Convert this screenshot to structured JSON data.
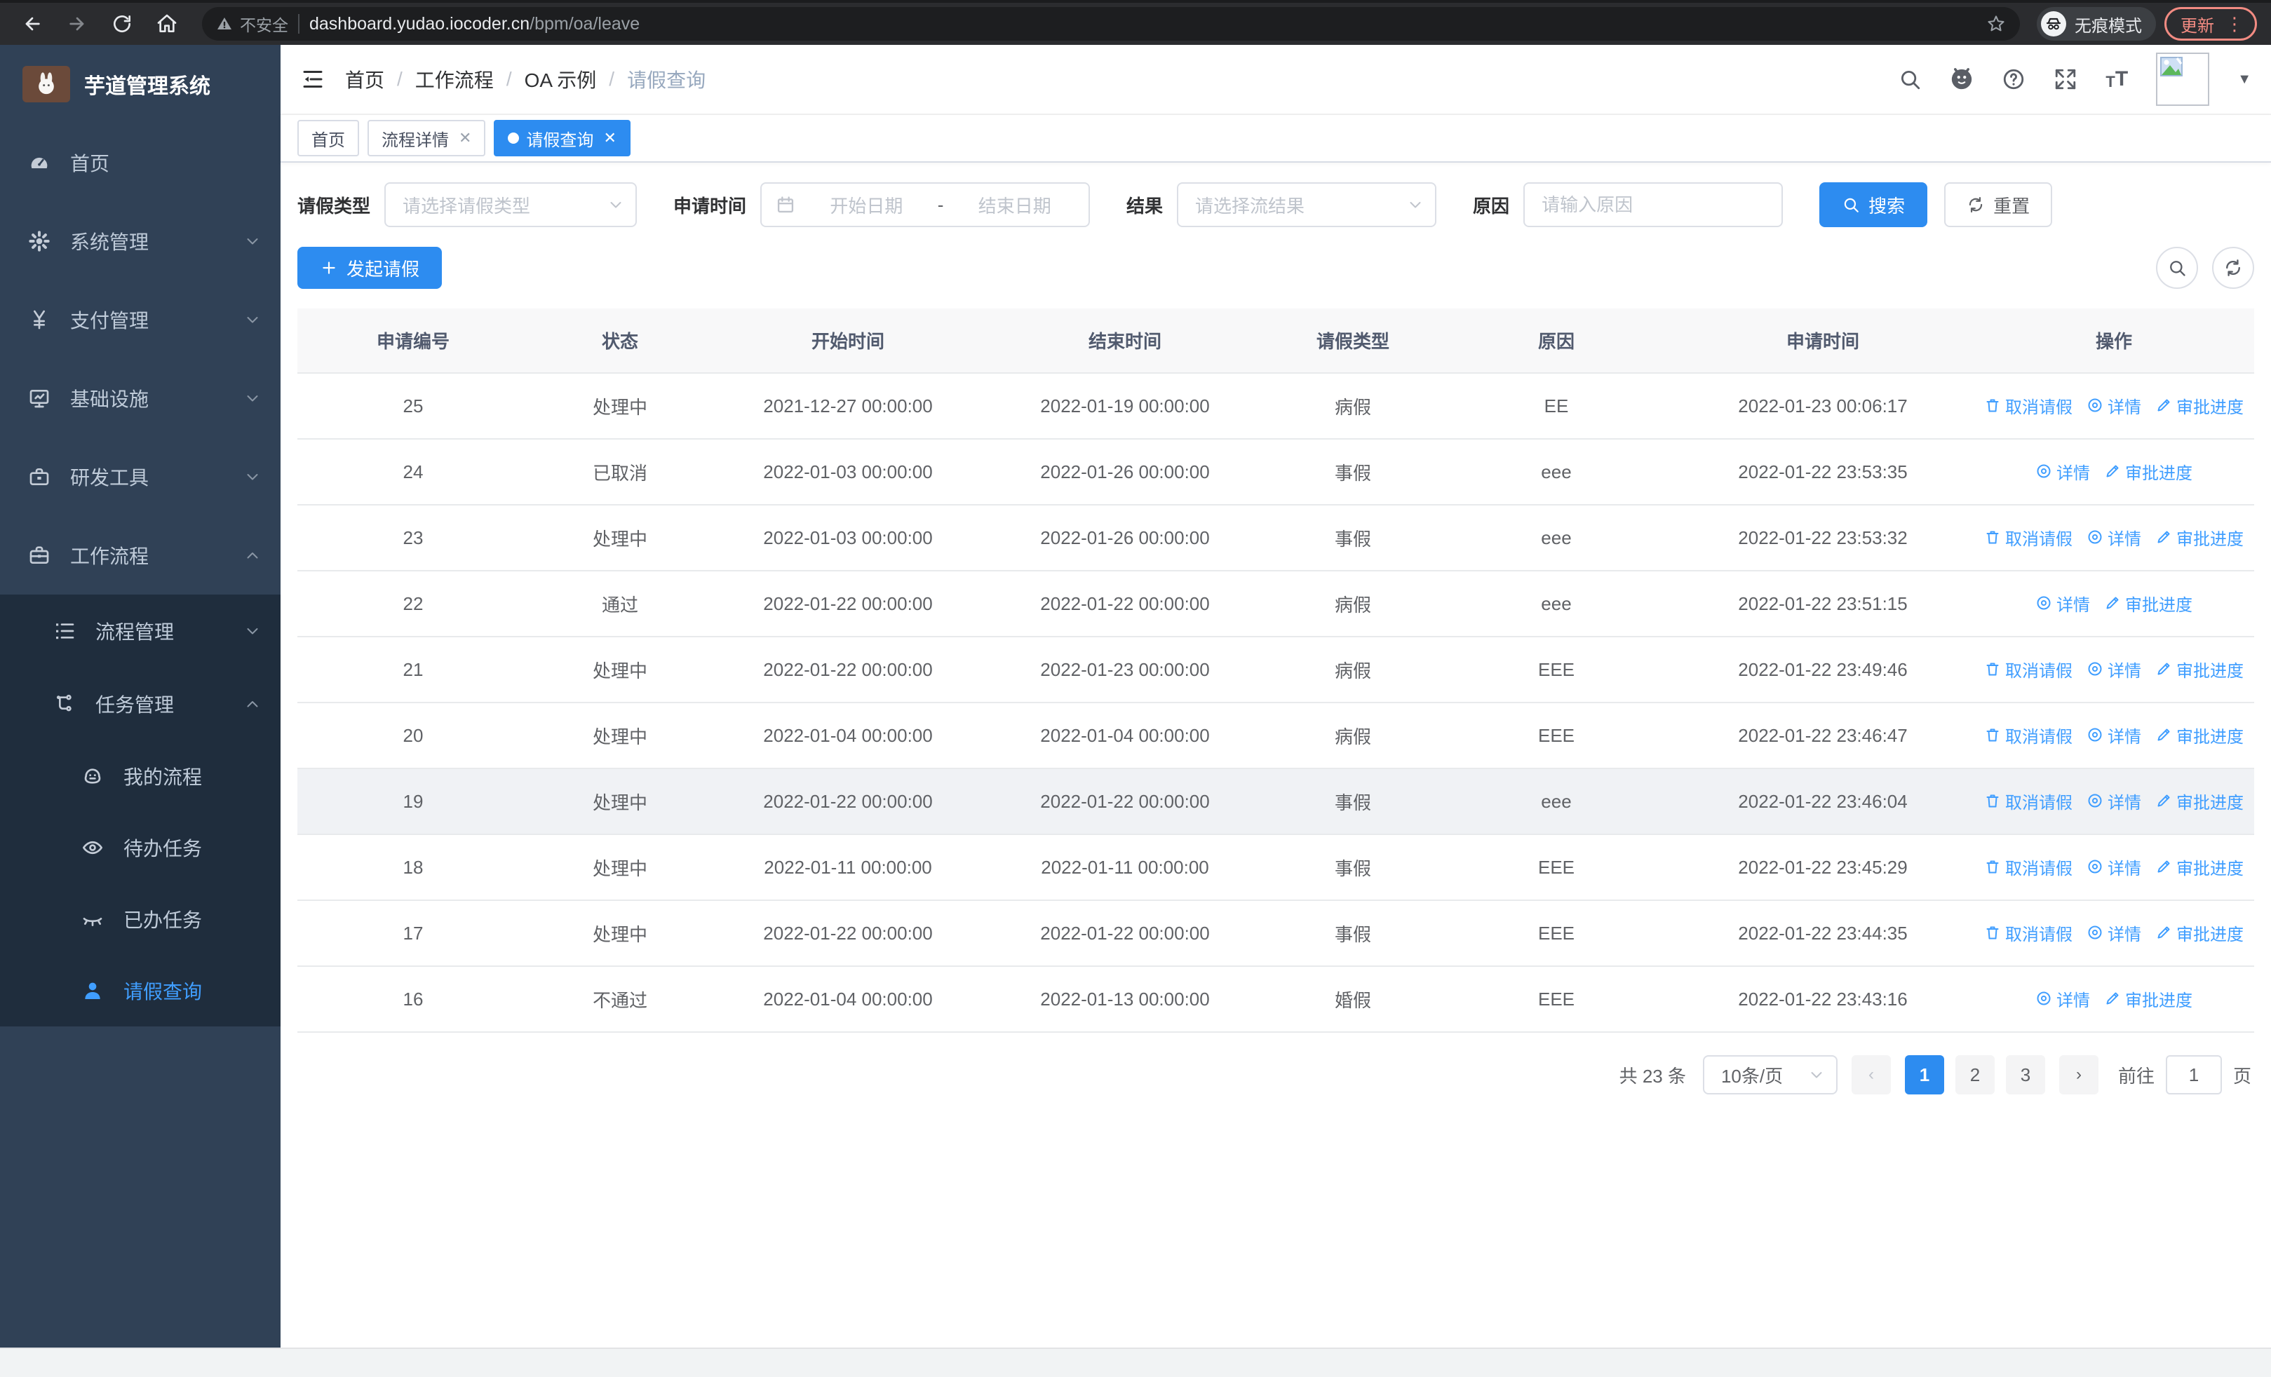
{
  "browser": {
    "security_label": "不安全",
    "url_host": "dashboard.yudao.iocoder.cn",
    "url_path": "/bpm/oa/leave",
    "incognito_label": "无痕模式",
    "update_label": "更新"
  },
  "sidebar": {
    "logo_title": "芋道管理系统",
    "menu": [
      {
        "key": "home",
        "icon": "dashboard-icon",
        "label": "首页",
        "level": 1,
        "sub": false,
        "chevron": "",
        "active": false
      },
      {
        "key": "system",
        "icon": "gear-icon",
        "label": "系统管理",
        "level": 1,
        "sub": false,
        "chevron": "down",
        "active": false
      },
      {
        "key": "payment",
        "icon": "yen-icon",
        "label": "支付管理",
        "level": 1,
        "sub": false,
        "chevron": "down",
        "active": false
      },
      {
        "key": "infra",
        "icon": "monitor-icon",
        "label": "基础设施",
        "level": 1,
        "sub": false,
        "chevron": "down",
        "active": false
      },
      {
        "key": "dev-tools",
        "icon": "toolbox-icon",
        "label": "研发工具",
        "level": 1,
        "sub": false,
        "chevron": "down",
        "active": false
      },
      {
        "key": "workflow",
        "icon": "briefcase-icon",
        "label": "工作流程",
        "level": 1,
        "sub": false,
        "chevron": "up",
        "active": false
      },
      {
        "key": "process-mgmt",
        "icon": "list-icon",
        "label": "流程管理",
        "level": 2,
        "sub": true,
        "chevron": "down",
        "active": false
      },
      {
        "key": "task-mgmt",
        "icon": "flow-icon",
        "label": "任务管理",
        "level": 2,
        "sub": true,
        "chevron": "up",
        "active": false
      },
      {
        "key": "my-process",
        "icon": "robot-icon",
        "label": "我的流程",
        "level": 3,
        "sub": true,
        "chevron": "",
        "active": false
      },
      {
        "key": "todo-tasks",
        "icon": "eye-icon",
        "label": "待办任务",
        "level": 3,
        "sub": true,
        "chevron": "",
        "active": false
      },
      {
        "key": "done-tasks",
        "icon": "eye-closed-icon",
        "label": "已办任务",
        "level": 3,
        "sub": true,
        "chevron": "",
        "active": false
      },
      {
        "key": "leave-query",
        "icon": "user-icon",
        "label": "请假查询",
        "level": 3,
        "sub": true,
        "chevron": "",
        "active": true
      }
    ]
  },
  "breadcrumb": [
    "首页",
    "工作流程",
    "OA 示例",
    "请假查询"
  ],
  "tabs": [
    {
      "key": "home",
      "label": "首页",
      "active": false,
      "closable": false,
      "dot": false
    },
    {
      "key": "process-detail",
      "label": "流程详情",
      "active": false,
      "closable": true,
      "dot": false
    },
    {
      "key": "leave-query",
      "label": "请假查询",
      "active": true,
      "closable": true,
      "dot": true
    }
  ],
  "filters": {
    "leave_type_label": "请假类型",
    "leave_type_placeholder": "请选择请假类型",
    "apply_time_label": "申请时间",
    "date_start_placeholder": "开始日期",
    "date_separator": "-",
    "date_end_placeholder": "结束日期",
    "result_label": "结果",
    "result_placeholder": "请选择流结果",
    "reason_label": "原因",
    "reason_placeholder": "请输入原因",
    "search_label": "搜索",
    "reset_label": "重置"
  },
  "toolbar": {
    "create_label": "发起请假"
  },
  "table": {
    "columns": [
      "申请编号",
      "状态",
      "开始时间",
      "结束时间",
      "请假类型",
      "原因",
      "申请时间",
      "操作"
    ],
    "action_labels": {
      "cancel": "取消请假",
      "detail": "详情",
      "progress": "审批进度"
    },
    "rows": [
      {
        "id": "25",
        "status": "处理中",
        "start": "2021-12-27 00:00:00",
        "end": "2022-01-19 00:00:00",
        "type": "病假",
        "reason": "EE",
        "applied": "2022-01-23 00:06:17",
        "cancelable": true,
        "highlighted": false
      },
      {
        "id": "24",
        "status": "已取消",
        "start": "2022-01-03 00:00:00",
        "end": "2022-01-26 00:00:00",
        "type": "事假",
        "reason": "eee",
        "applied": "2022-01-22 23:53:35",
        "cancelable": false,
        "highlighted": false
      },
      {
        "id": "23",
        "status": "处理中",
        "start": "2022-01-03 00:00:00",
        "end": "2022-01-26 00:00:00",
        "type": "事假",
        "reason": "eee",
        "applied": "2022-01-22 23:53:32",
        "cancelable": true,
        "highlighted": false
      },
      {
        "id": "22",
        "status": "通过",
        "start": "2022-01-22 00:00:00",
        "end": "2022-01-22 00:00:00",
        "type": "病假",
        "reason": "eee",
        "applied": "2022-01-22 23:51:15",
        "cancelable": false,
        "highlighted": false
      },
      {
        "id": "21",
        "status": "处理中",
        "start": "2022-01-22 00:00:00",
        "end": "2022-01-23 00:00:00",
        "type": "病假",
        "reason": "EEE",
        "applied": "2022-01-22 23:49:46",
        "cancelable": true,
        "highlighted": false
      },
      {
        "id": "20",
        "status": "处理中",
        "start": "2022-01-04 00:00:00",
        "end": "2022-01-04 00:00:00",
        "type": "病假",
        "reason": "EEE",
        "applied": "2022-01-22 23:46:47",
        "cancelable": true,
        "highlighted": false
      },
      {
        "id": "19",
        "status": "处理中",
        "start": "2022-01-22 00:00:00",
        "end": "2022-01-22 00:00:00",
        "type": "事假",
        "reason": "eee",
        "applied": "2022-01-22 23:46:04",
        "cancelable": true,
        "highlighted": true
      },
      {
        "id": "18",
        "status": "处理中",
        "start": "2022-01-11 00:00:00",
        "end": "2022-01-11 00:00:00",
        "type": "事假",
        "reason": "EEE",
        "applied": "2022-01-22 23:45:29",
        "cancelable": true,
        "highlighted": false
      },
      {
        "id": "17",
        "status": "处理中",
        "start": "2022-01-22 00:00:00",
        "end": "2022-01-22 00:00:00",
        "type": "事假",
        "reason": "EEE",
        "applied": "2022-01-22 23:44:35",
        "cancelable": true,
        "highlighted": false
      },
      {
        "id": "16",
        "status": "不通过",
        "start": "2022-01-04 00:00:00",
        "end": "2022-01-13 00:00:00",
        "type": "婚假",
        "reason": "EEE",
        "applied": "2022-01-22 23:43:16",
        "cancelable": false,
        "highlighted": false
      }
    ]
  },
  "pagination": {
    "total_text": "共 23 条",
    "page_size": "10条/页",
    "pages": [
      "1",
      "2",
      "3"
    ],
    "active_page": "1",
    "goto_label": "前往",
    "goto_value": "1",
    "goto_unit": "页"
  },
  "colors": {
    "primary": "#2d8cf0",
    "link": "#409eff",
    "sidebar_bg": "#304156",
    "sidebar_submenu_bg": "#1f2d3d",
    "update_badge": "#f28b82"
  }
}
